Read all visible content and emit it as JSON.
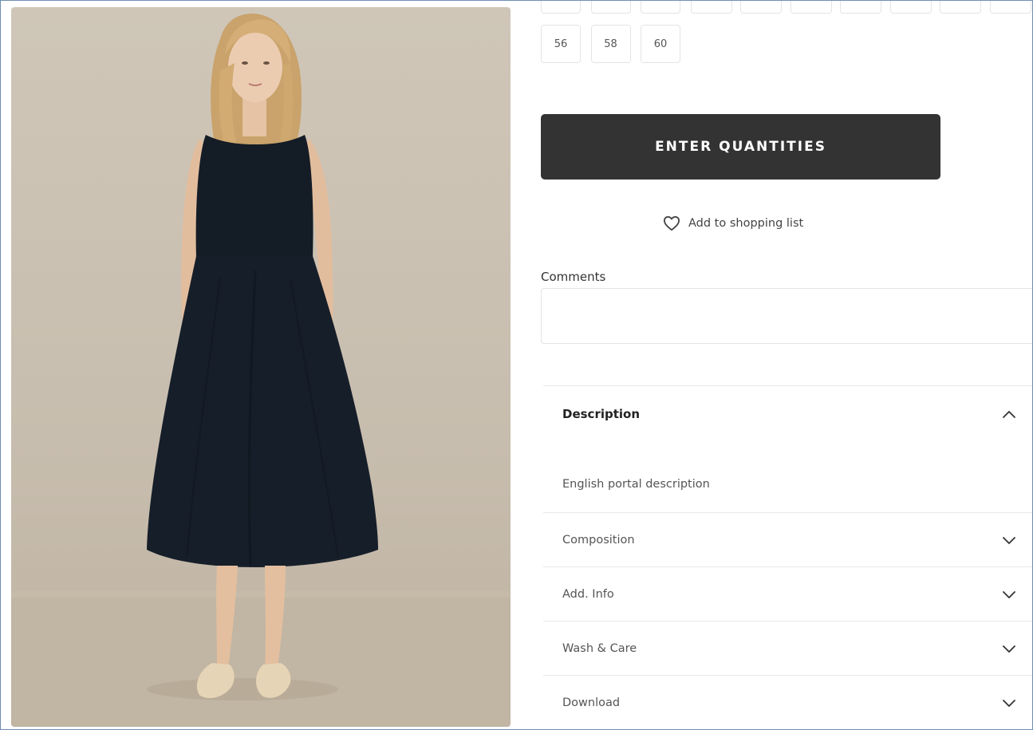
{
  "sizes": {
    "partial_row_count": 10,
    "visible": [
      "56",
      "58",
      "60"
    ]
  },
  "actions": {
    "enter_quantities_label": "ENTER QUANTITIES",
    "shopping_list_label": "Add to shopping list"
  },
  "comments": {
    "label": "Comments",
    "value": "",
    "placeholder": ""
  },
  "accordion": {
    "description": {
      "title": "Description",
      "body": "English portal description",
      "expanded": true
    },
    "sections": [
      {
        "title": "Composition",
        "expanded": false
      },
      {
        "title": "Add. Info",
        "expanded": false
      },
      {
        "title": "Wash & Care",
        "expanded": false
      },
      {
        "title": "Download",
        "expanded": false
      }
    ]
  },
  "icons": {
    "wishlist": "heart-outline-icon",
    "expanded": "chevron-up-icon",
    "collapsed": "chevron-down-icon"
  },
  "colors": {
    "button_bg": "#333333",
    "button_text": "#ffffff",
    "dress": "#141c26",
    "background": "#cfc6b8"
  }
}
